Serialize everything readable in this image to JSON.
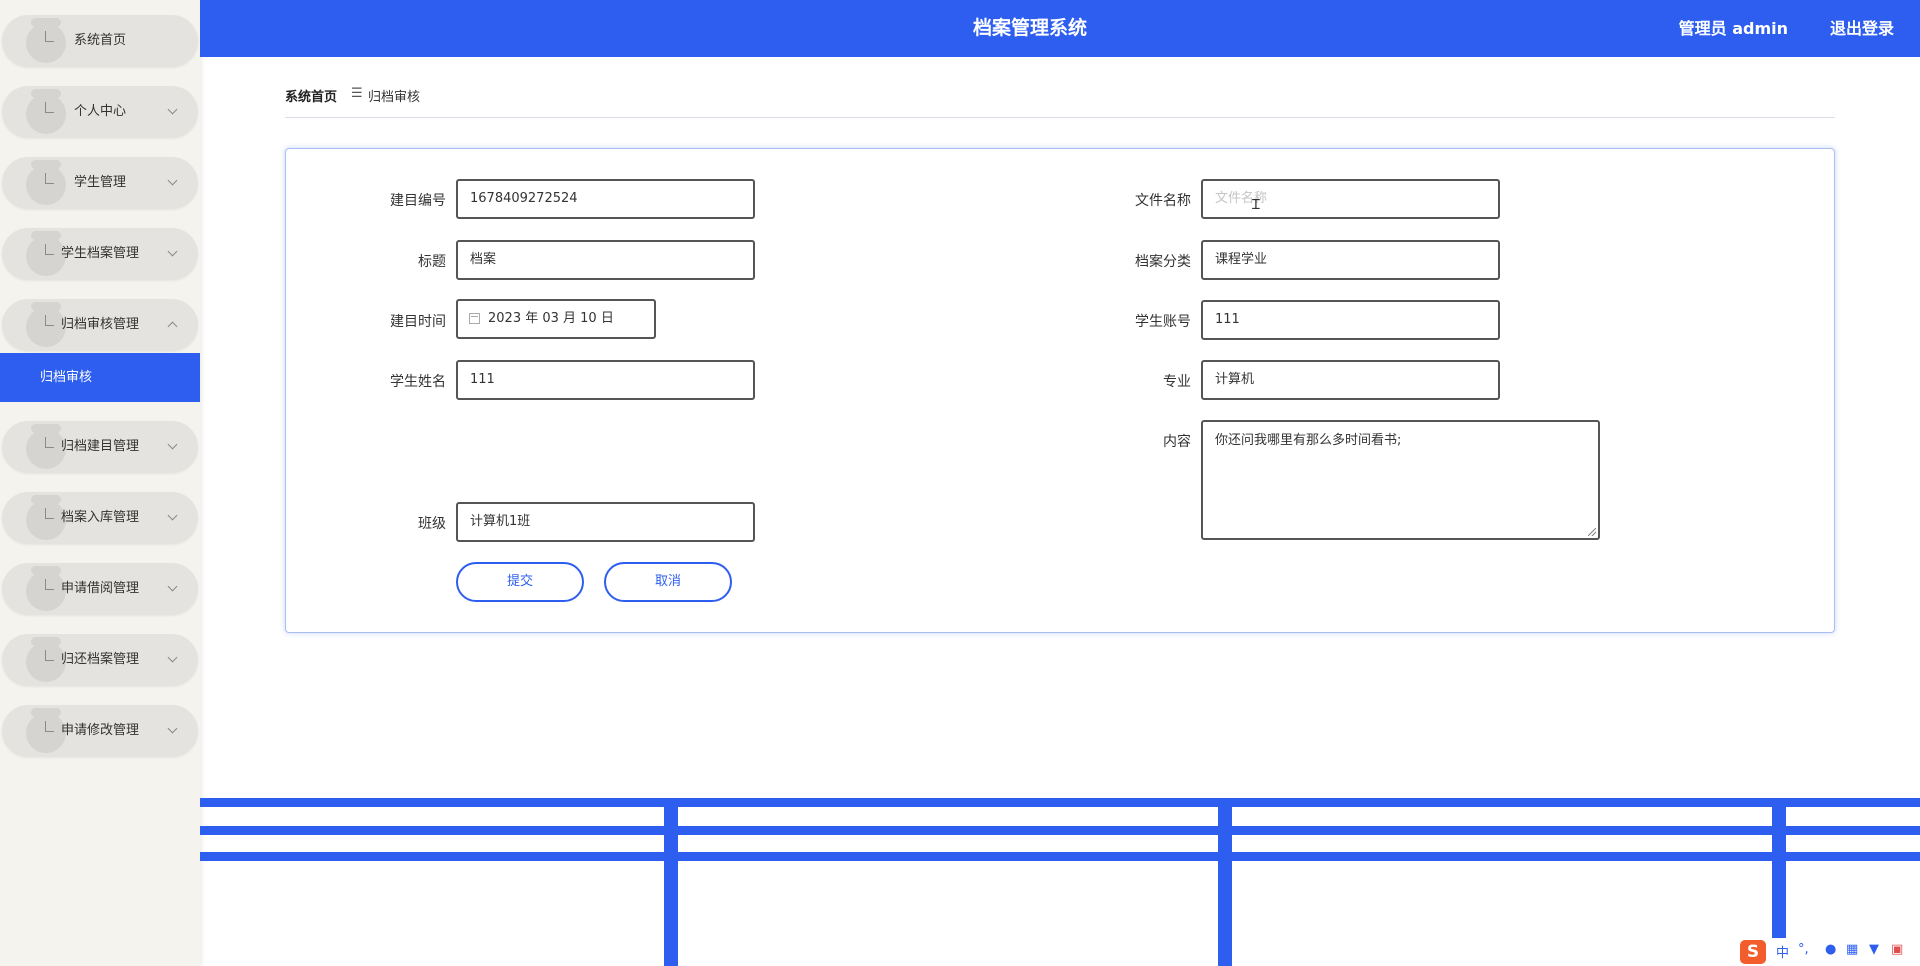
{
  "header": {
    "title": "档案管理系统",
    "user": "管理员 admin",
    "logout": "退出登录"
  },
  "sidebar": {
    "items": [
      {
        "label": "系统首页",
        "chevron": "none"
      },
      {
        "label": "个人中心",
        "chevron": "down"
      },
      {
        "label": "学生管理",
        "chevron": "down"
      },
      {
        "label": "学生档案管理",
        "chevron": "down"
      },
      {
        "label": "归档审核管理",
        "chevron": "up"
      },
      {
        "label": "归档建目管理",
        "chevron": "down"
      },
      {
        "label": "档案入库管理",
        "chevron": "down"
      },
      {
        "label": "申请借阅管理",
        "chevron": "down"
      },
      {
        "label": "归还档案管理",
        "chevron": "down"
      },
      {
        "label": "申请修改管理",
        "chevron": "down"
      }
    ],
    "active_sub": "归档审核"
  },
  "breadcrumb": {
    "home": "系统首页",
    "separator": "☰",
    "current": "归档审核"
  },
  "form": {
    "catalog_no": {
      "label": "建目编号",
      "value": "1678409272524"
    },
    "title": {
      "label": "标题",
      "value": "档案"
    },
    "catalog_time": {
      "label": "建目时间",
      "value": "2023 年 03 月 10 日"
    },
    "student_name": {
      "label": "学生姓名",
      "value": "111"
    },
    "class": {
      "label": "班级",
      "value": "计算机1班"
    },
    "file_name": {
      "label": "文件名称",
      "value": "",
      "placeholder": "文件名称"
    },
    "category": {
      "label": "档案分类",
      "value": "课程学业"
    },
    "student_account": {
      "label": "学生账号",
      "value": "111"
    },
    "major": {
      "label": "专业",
      "value": "计算机"
    },
    "content": {
      "label": "内容",
      "value": "你还问我哪里有那么多时间看书;"
    },
    "submit_label": "提交",
    "cancel_label": "取消"
  },
  "tray": {
    "ime_logo": "S",
    "ime_lang": "中",
    "ime_punct": "°,"
  },
  "colors": {
    "primary": "#2d5ef0",
    "sidebar_bg": "#f4f3ee",
    "menu_pill": "#e4e3df"
  }
}
